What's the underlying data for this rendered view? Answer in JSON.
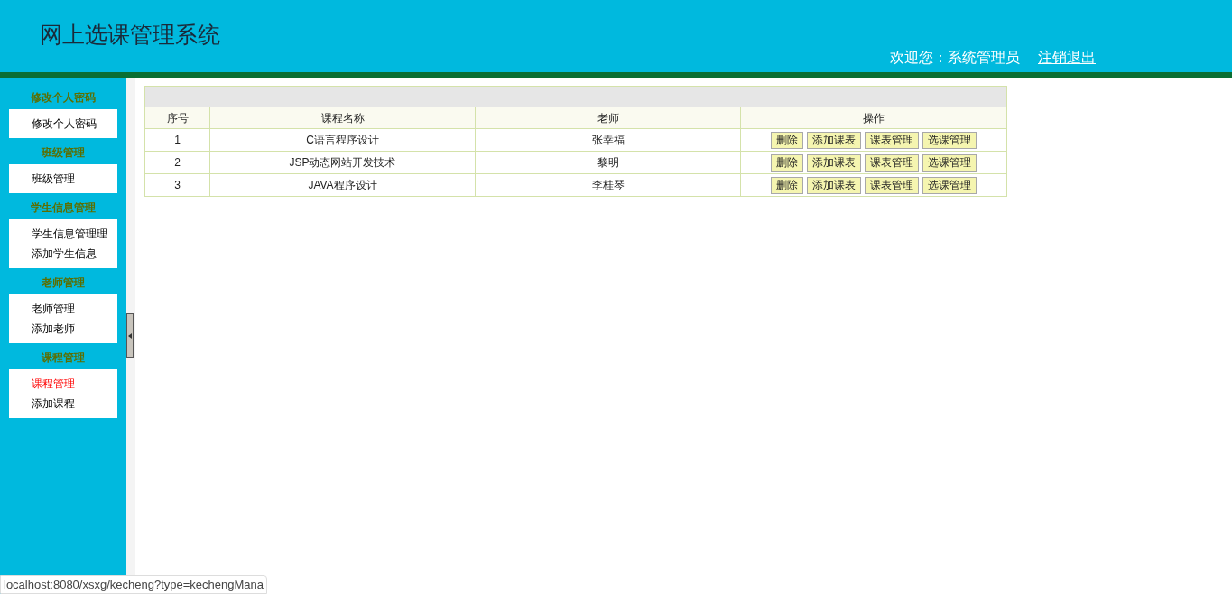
{
  "header": {
    "title": "网上选课管理系统",
    "welcome": "欢迎您：系统管理员",
    "logout": "注销退出"
  },
  "sidebar": {
    "sections": [
      {
        "title": "修改个人密码",
        "items": [
          {
            "label": "修改个人密码",
            "selected": false
          }
        ]
      },
      {
        "title": "班级管理",
        "items": [
          {
            "label": "班级管理",
            "selected": false
          }
        ]
      },
      {
        "title": "学生信息管理",
        "items": [
          {
            "label": "学生信息管理理",
            "selected": false
          },
          {
            "label": "添加学生信息",
            "selected": false
          }
        ]
      },
      {
        "title": "老师管理",
        "items": [
          {
            "label": "老师管理",
            "selected": false
          },
          {
            "label": "添加老师",
            "selected": false
          }
        ]
      },
      {
        "title": "课程管理",
        "items": [
          {
            "label": "课程管理",
            "selected": true
          },
          {
            "label": "添加课程",
            "selected": false
          }
        ]
      }
    ]
  },
  "table": {
    "columns": [
      "序号",
      "课程名称",
      "老师",
      "操作"
    ],
    "rows": [
      {
        "index": "1",
        "course": "C语言程序设计",
        "teacher": "张幸福",
        "actions": [
          "删除",
          "添加课表",
          "课表管理",
          "选课管理"
        ]
      },
      {
        "index": "2",
        "course": "JSP动态网站开发技术",
        "teacher": "黎明",
        "actions": [
          "删除",
          "添加课表",
          "课表管理",
          "选课管理"
        ]
      },
      {
        "index": "3",
        "course": "JAVA程序设计",
        "teacher": "李桂琴",
        "actions": [
          "删除",
          "添加课表",
          "课表管理",
          "选课管理"
        ]
      }
    ]
  },
  "status_bar": {
    "url": "localhost:8080/xsxg/kecheng?type=kechengMana"
  }
}
